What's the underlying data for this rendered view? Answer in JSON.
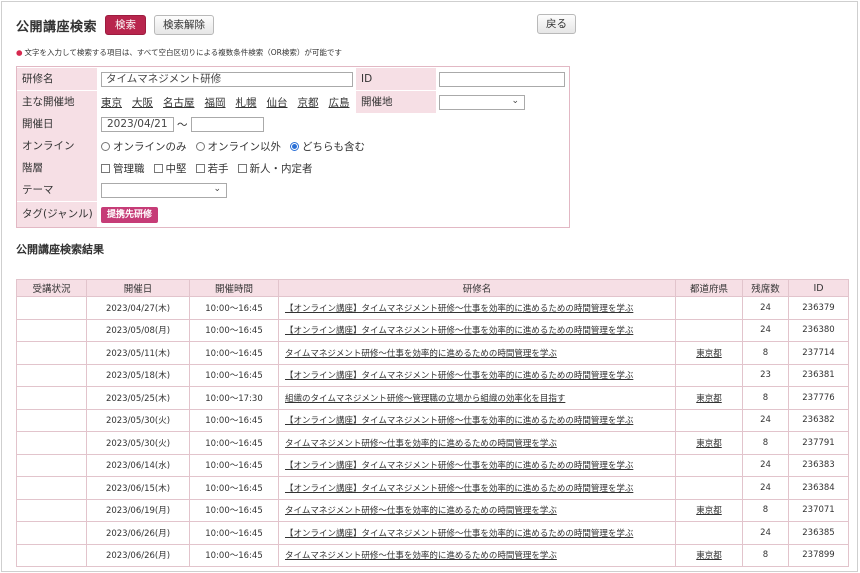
{
  "header": {
    "title": "公開講座検索",
    "search_label": "検索",
    "clear_label": "検索解除",
    "back_label": "戻る"
  },
  "note": "文字を入力して検索する項目は、すべて空白区切りによる複数条件検索（OR検索）が可能です",
  "form": {
    "course_name": {
      "label": "研修名",
      "value": "タイムマネジメント研修"
    },
    "id": {
      "label": "ID",
      "value": ""
    },
    "main_venue": {
      "label": "主な開催地",
      "areas": [
        "東京",
        "大阪",
        "名古屋",
        "福岡",
        "札幌",
        "仙台",
        "京都",
        "広島"
      ]
    },
    "venue": {
      "label": "開催地",
      "value": ""
    },
    "date": {
      "label": "開催日",
      "from": "2023/04/21",
      "separator": "〜",
      "to": ""
    },
    "online": {
      "label": "オンライン",
      "options": [
        "オンラインのみ",
        "オンライン以外",
        "どちらも含む"
      ],
      "selected": 2
    },
    "level": {
      "label": "階層",
      "options": [
        "管理職",
        "中堅",
        "若手",
        "新人・内定者"
      ]
    },
    "theme": {
      "label": "テーマ",
      "value": ""
    },
    "tag": {
      "label": "タグ(ジャンル)",
      "button": "提携先研修"
    }
  },
  "results": {
    "title": "公開講座検索結果",
    "columns": [
      "受講状況",
      "開催日",
      "開催時間",
      "研修名",
      "都道府県",
      "残席数",
      "ID"
    ],
    "rows": [
      {
        "status": "",
        "date": "2023/04/27(木)",
        "time": "10:00〜16:45",
        "name": "【オンライン講座】タイムマネジメント研修〜仕事を効率的に進めるための時間管理を学ぶ",
        "pref": "",
        "seats": "24",
        "id": "236379"
      },
      {
        "status": "",
        "date": "2023/05/08(月)",
        "time": "10:00〜16:45",
        "name": "【オンライン講座】タイムマネジメント研修〜仕事を効率的に進めるための時間管理を学ぶ",
        "pref": "",
        "seats": "24",
        "id": "236380"
      },
      {
        "status": "",
        "date": "2023/05/11(木)",
        "time": "10:00〜16:45",
        "name": "タイムマネジメント研修〜仕事を効率的に進めるための時間管理を学ぶ",
        "pref": "東京都",
        "seats": "8",
        "id": "237714"
      },
      {
        "status": "",
        "date": "2023/05/18(木)",
        "time": "10:00〜16:45",
        "name": "【オンライン講座】タイムマネジメント研修〜仕事を効率的に進めるための時間管理を学ぶ",
        "pref": "",
        "seats": "23",
        "id": "236381"
      },
      {
        "status": "",
        "date": "2023/05/25(木)",
        "time": "10:00〜17:30",
        "name": "組織のタイムマネジメント研修〜管理職の立場から組織の効率化を目指す",
        "pref": "東京都",
        "seats": "8",
        "id": "237776"
      },
      {
        "status": "",
        "date": "2023/05/30(火)",
        "time": "10:00〜16:45",
        "name": "【オンライン講座】タイムマネジメント研修〜仕事を効率的に進めるための時間管理を学ぶ",
        "pref": "",
        "seats": "24",
        "id": "236382"
      },
      {
        "status": "",
        "date": "2023/05/30(火)",
        "time": "10:00〜16:45",
        "name": "タイムマネジメント研修〜仕事を効率的に進めるための時間管理を学ぶ",
        "pref": "東京都",
        "seats": "8",
        "id": "237791"
      },
      {
        "status": "",
        "date": "2023/06/14(水)",
        "time": "10:00〜16:45",
        "name": "【オンライン講座】タイムマネジメント研修〜仕事を効率的に進めるための時間管理を学ぶ",
        "pref": "",
        "seats": "24",
        "id": "236383"
      },
      {
        "status": "",
        "date": "2023/06/15(木)",
        "time": "10:00〜16:45",
        "name": "【オンライン講座】タイムマネジメント研修〜仕事を効率的に進めるための時間管理を学ぶ",
        "pref": "",
        "seats": "24",
        "id": "236384"
      },
      {
        "status": "",
        "date": "2023/06/19(月)",
        "time": "10:00〜16:45",
        "name": "タイムマネジメント研修〜仕事を効率的に進めるための時間管理を学ぶ",
        "pref": "東京都",
        "seats": "8",
        "id": "237071"
      },
      {
        "status": "",
        "date": "2023/06/26(月)",
        "time": "10:00〜16:45",
        "name": "【オンライン講座】タイムマネジメント研修〜仕事を効率的に進めるための時間管理を学ぶ",
        "pref": "",
        "seats": "24",
        "id": "236385"
      },
      {
        "status": "",
        "date": "2023/06/26(月)",
        "time": "10:00〜16:45",
        "name": "タイムマネジメント研修〜仕事を効率的に進めるための時間管理を学ぶ",
        "pref": "東京都",
        "seats": "8",
        "id": "237899"
      }
    ]
  },
  "colors": {
    "accent": "#b8254d",
    "label_bg": "#f6dfe5",
    "tag": "#c63c77",
    "radio": "#2a6fd6"
  }
}
